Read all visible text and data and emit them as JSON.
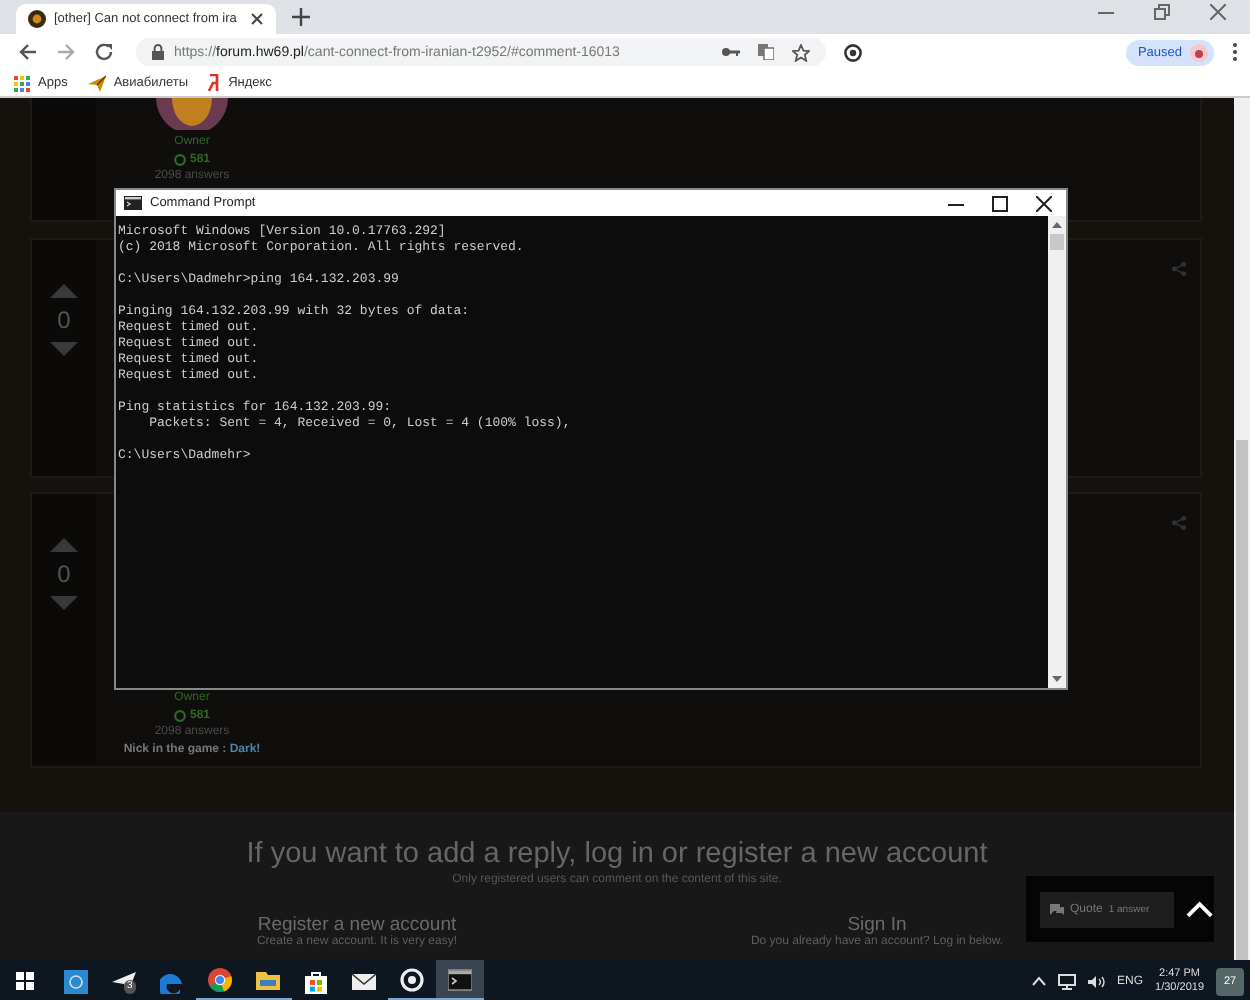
{
  "browser": {
    "tab": {
      "title": "[other] Can not connect from ira"
    },
    "address": {
      "scheme": "https://",
      "domain": "forum.hw69.pl",
      "path": "/cant-connect-from-iranian-t2952/#comment-16013"
    },
    "profile": {
      "label": "Paused"
    },
    "bookmarks": [
      {
        "kind": "apps",
        "label": "Apps"
      },
      {
        "kind": "plane",
        "label": "Авиабилеты"
      },
      {
        "kind": "yandex",
        "label": "Яндекс"
      }
    ]
  },
  "forum": {
    "posts": [
      {
        "kind": "tail",
        "author": {
          "role": "Owner",
          "reputation": "581",
          "answers": "2098 answers"
        }
      },
      {
        "kind": "vote",
        "votes": "0"
      },
      {
        "kind": "vote",
        "votes": "0",
        "author": {
          "role": "Owner",
          "reputation": "581",
          "answers": "2098 answers",
          "signature": "Nick in the game : **Dark!**"
        }
      }
    ],
    "footer": {
      "heading": "If you want to add a reply, log in or register a new account",
      "subheading": "Only registered users can comment on the content of this site.",
      "options": [
        {
          "title": "Register a new account",
          "text": "Create a new account. It is very easy!"
        },
        {
          "title": "Sign In",
          "text": "Do you already have an account? Log in below."
        }
      ]
    },
    "quote": {
      "label": "Quote",
      "count": "1 answer"
    }
  },
  "console": {
    "title": "Command Prompt",
    "blocks": [
      [
        "Microsoft Windows [Version 10.0.17763.292]",
        "(c) 2018 Microsoft Corporation. All rights reserved."
      ],
      [
        "C:\\Users\\Dadmehr>ping 164.132.203.99"
      ],
      [
        "Pinging 164.132.203.99 with 32 bytes of data:",
        "Request timed out.",
        "Request timed out.",
        "Request timed out.",
        "Request timed out."
      ],
      [
        "Ping statistics for 164.132.203.99:",
        "    Packets: Sent = 4, Received = 0, Lost = 4 (100% loss),"
      ],
      [
        "C:\\Users\\Dadmehr>"
      ]
    ]
  },
  "taskbar": {
    "apps": [
      {
        "kind": "tile",
        "running": false,
        "selected": false
      },
      {
        "kind": "plane",
        "running": false,
        "selected": false,
        "badge": "3"
      },
      {
        "kind": "edge",
        "running": false,
        "selected": false
      },
      {
        "kind": "chrome",
        "running": true,
        "selected": false
      },
      {
        "kind": "folder",
        "running": true,
        "selected": false
      },
      {
        "kind": "store",
        "running": false,
        "selected": false
      },
      {
        "kind": "mail",
        "running": false,
        "selected": false
      },
      {
        "kind": "ring",
        "running": true,
        "selected": false
      },
      {
        "kind": "console",
        "running": true,
        "selected": true
      }
    ],
    "language": "ENG",
    "time": "2:47 PM",
    "date": "1/30/2019",
    "notifications": "27"
  }
}
